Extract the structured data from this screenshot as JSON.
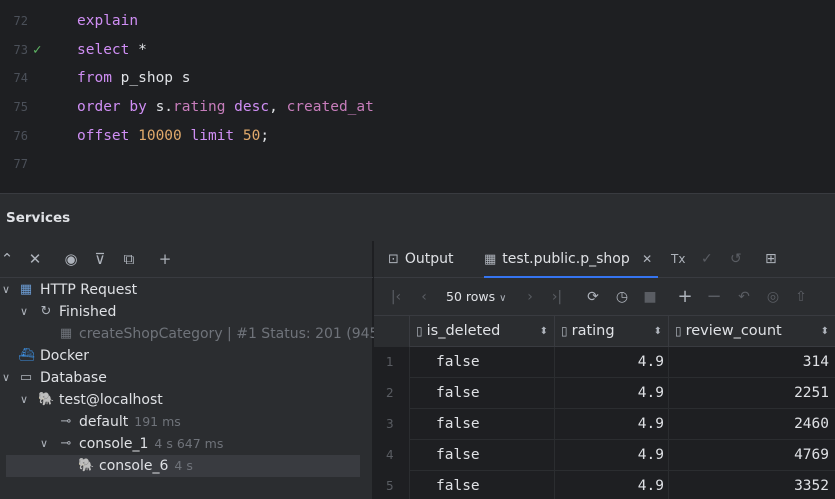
{
  "editor": {
    "lines": [
      {
        "num": "72",
        "mark": ""
      },
      {
        "num": "73",
        "mark": "check"
      },
      {
        "num": "74",
        "mark": ""
      },
      {
        "num": "75",
        "mark": ""
      },
      {
        "num": "76",
        "mark": ""
      },
      {
        "num": "77",
        "mark": ""
      }
    ],
    "code": {
      "l72_kw": "explain",
      "l73_kw": "select",
      "l73_star": " *",
      "l74_kw": "from",
      "l74_table": " p_shop s",
      "l75_kw1": "order by",
      "l75_alias": " s.",
      "l75_field1": "rating",
      "l75_kw2": " desc",
      "l75_comma": ", ",
      "l75_field2": "created_at",
      "l76_kw1": "offset",
      "l76_num1": " 10000",
      "l76_kw2": " limit",
      "l76_num2": " 50",
      "l76_semi": ";"
    }
  },
  "services": {
    "title": "Services"
  },
  "tree": {
    "http_request": "HTTP Request",
    "finished": "Finished",
    "request_item": "createShopCategory | #1 Status: 201 (945",
    "docker": "Docker",
    "database": "Database",
    "connection": "test@localhost",
    "default_label": "default",
    "default_time": "191 ms",
    "console1_label": "console_1",
    "console1_time": "4 s 647 ms",
    "console6_label": "console_6",
    "console6_time": "4 s"
  },
  "results": {
    "tab_output": "Output",
    "tab_table": "test.public.p_shop",
    "tab_tx": "Tx",
    "rows_select": "50 rows",
    "columns": [
      "is_deleted",
      "rating",
      "review_count"
    ],
    "rows": [
      {
        "n": "1",
        "is_deleted": "false",
        "rating": "4.9",
        "review_count": "314"
      },
      {
        "n": "2",
        "is_deleted": "false",
        "rating": "4.9",
        "review_count": "2251"
      },
      {
        "n": "3",
        "is_deleted": "false",
        "rating": "4.9",
        "review_count": "2460"
      },
      {
        "n": "4",
        "is_deleted": "false",
        "rating": "4.9",
        "review_count": "4769"
      },
      {
        "n": "5",
        "is_deleted": "false",
        "rating": "4.9",
        "review_count": "3352"
      }
    ]
  },
  "colors": {
    "keyword": "#cf8ef4",
    "field": "#c77dbb",
    "number": "#2aacb8",
    "accent": "#3574f0",
    "success": "#5fb865"
  }
}
